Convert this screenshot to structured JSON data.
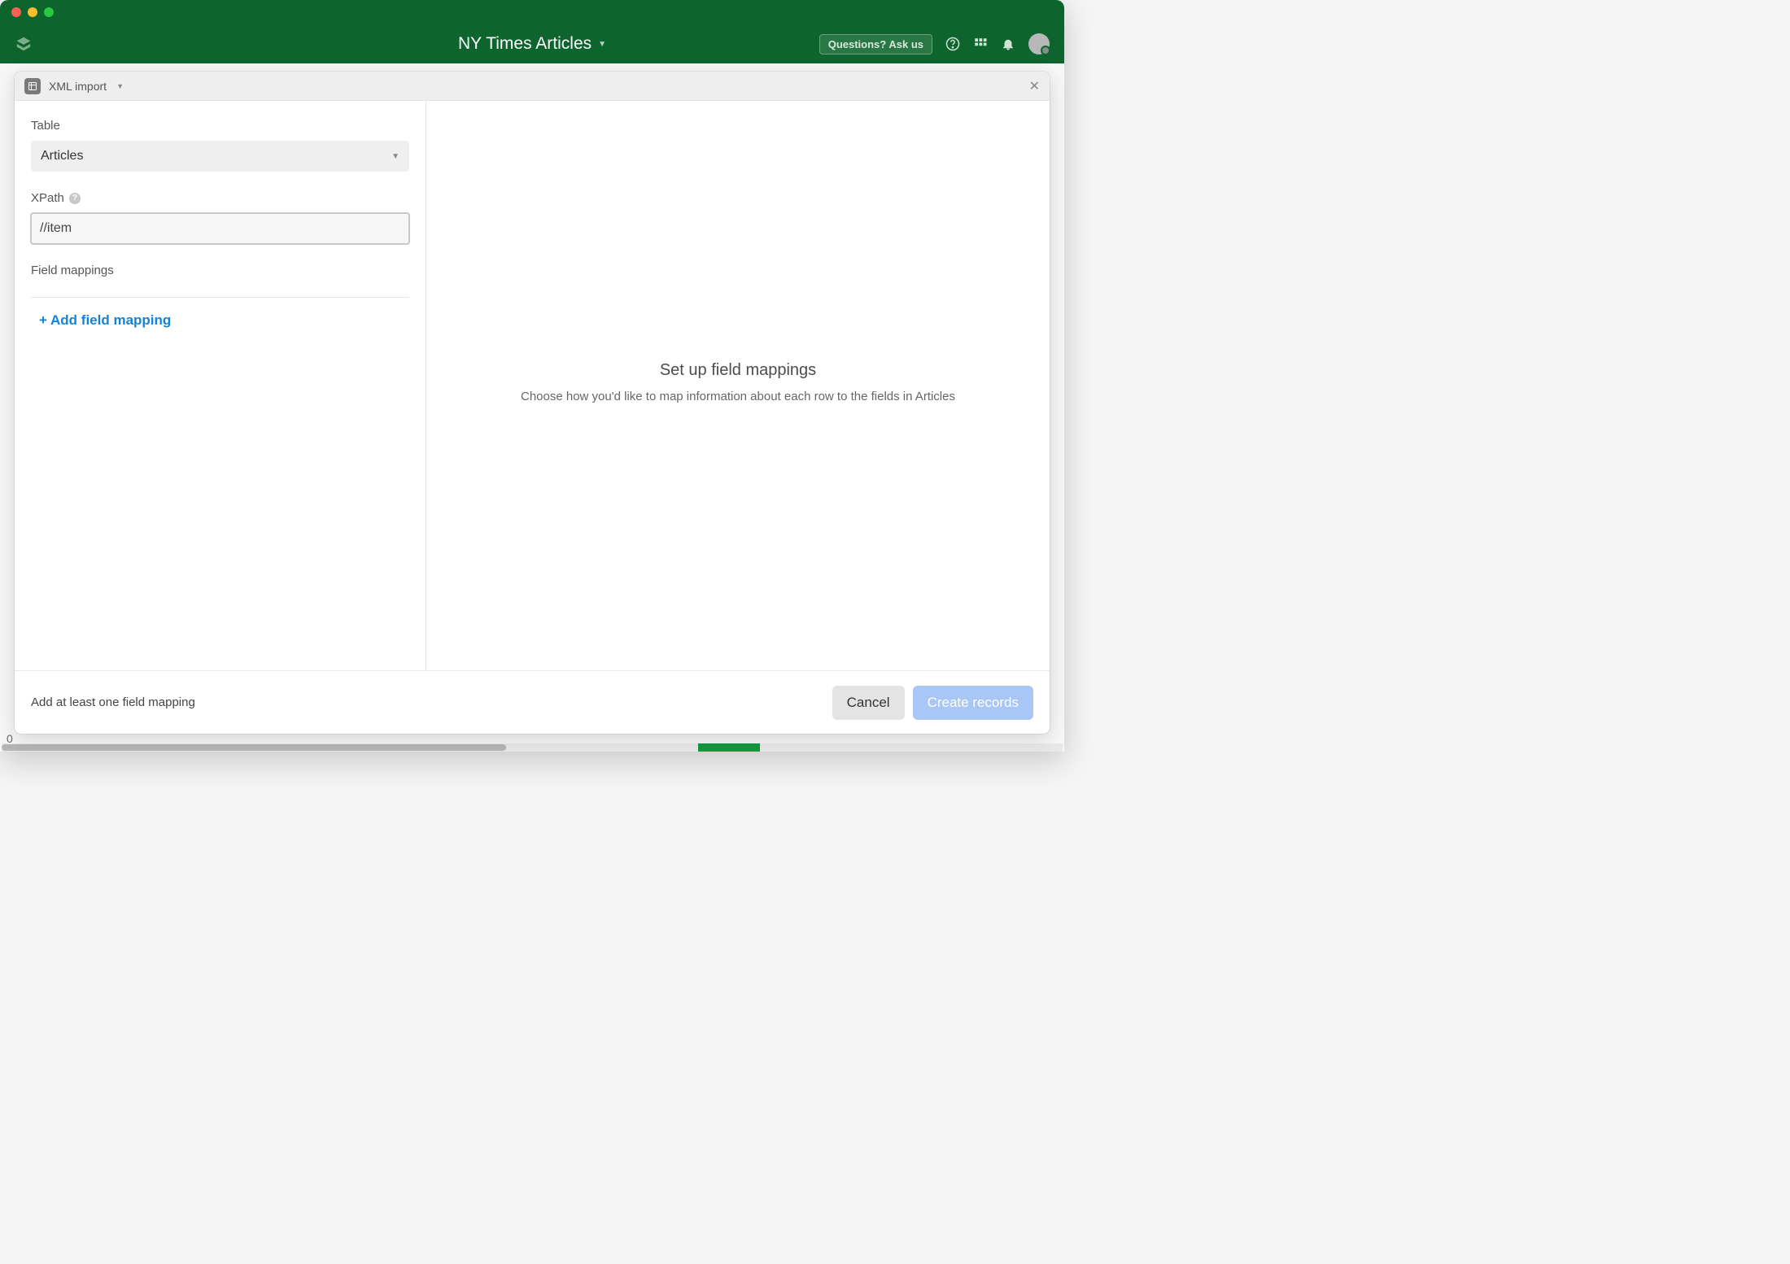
{
  "app": {
    "title": "NY Times Articles",
    "ask_label": "Questions? Ask us"
  },
  "modal": {
    "title": "XML import",
    "close_glyph": "✕",
    "footer_message": "Add at least one field mapping",
    "cancel_label": "Cancel",
    "create_label": "Create records"
  },
  "form": {
    "table_label": "Table",
    "table_value": "Articles",
    "xpath_label": "XPath",
    "xpath_value": "//item",
    "field_mappings_label": "Field mappings",
    "add_mapping_label": "+ Add field mapping"
  },
  "right_pane": {
    "title": "Set up field mappings",
    "subtitle": "Choose how you'd like to map information about each row to the fields in Articles"
  },
  "bg": {
    "zero": "0"
  }
}
